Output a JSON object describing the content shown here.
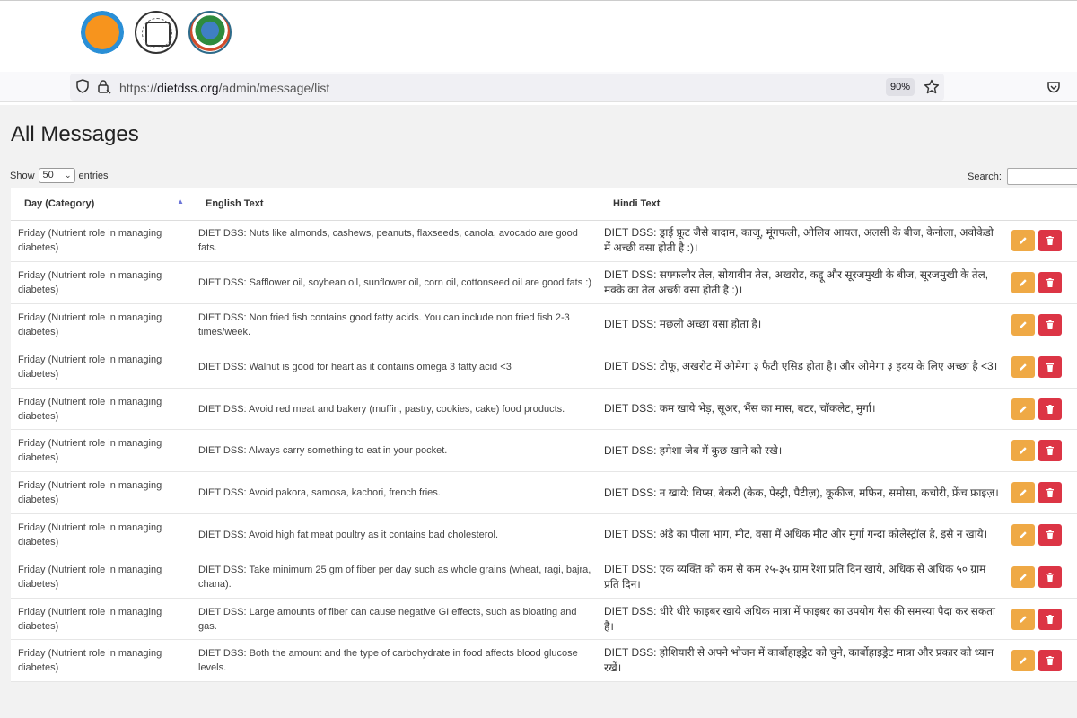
{
  "url": {
    "scheme": "https://",
    "host": "dietdss.org",
    "path": "/admin/message/list"
  },
  "zoom": "90%",
  "page": {
    "title": "All Messages",
    "show_label": "Show",
    "entries_value": "50",
    "entries_label": "entries",
    "search_label": "Search:"
  },
  "table": {
    "headers": [
      "Day (Category)",
      "English Text",
      "Hindi Text"
    ],
    "rows": [
      {
        "day": "Friday (Nutrient role in managing diabetes)",
        "english": "DIET DSS: Nuts like almonds, cashews, peanuts, flaxseeds, canola, avocado are good fats.",
        "hindi": "DIET DSS: ड्राई फ्रूट जैसे बादाम, काजू, मूंगफली, ओलिव आयल, अलसी के बीज, केनोला, अवोकेडो में अच्छी वसा होती है :)।"
      },
      {
        "day": "Friday (Nutrient role in managing diabetes)",
        "english": "DIET DSS: Safflower oil, soybean oil, sunflower oil, corn oil, cottonseed oil are good fats :)",
        "hindi": "DIET DSS: सफ्फलौर तेल, सोयाबीन तेल, अखरोट, कद्दू और सूरजमुखी के बीज, सूरजमुखी के तेल, मक्के का तेल अच्छी वसा होती है :)।"
      },
      {
        "day": "Friday (Nutrient role in managing diabetes)",
        "english": "DIET DSS: Non fried fish contains good fatty acids. You can include non fried fish 2-3 times/week.",
        "hindi": "DIET DSS: मछली अच्छा वसा होता है।"
      },
      {
        "day": "Friday (Nutrient role in managing diabetes)",
        "english": "DIET DSS: Walnut is good for heart as it contains omega 3 fatty acid <3",
        "hindi": "DIET DSS: टोफू, अखरोट में ओमेगा ३ फैटी एसिड होता है। और ओमेगा ३ हदय के लिए अच्छा है <3।"
      },
      {
        "day": "Friday (Nutrient role in managing diabetes)",
        "english": "DIET DSS: Avoid red meat and bakery (muffin, pastry, cookies, cake) food products.",
        "hindi": "DIET DSS: कम खाये भेड़, सूअर, भैंस का मास, बटर, चॉकलेट, मुर्गा।"
      },
      {
        "day": "Friday (Nutrient role in managing diabetes)",
        "english": "DIET DSS: Always carry something to eat in your pocket.",
        "hindi": "DIET DSS: हमेशा जेब में कुछ खाने को रखे।"
      },
      {
        "day": "Friday (Nutrient role in managing diabetes)",
        "english": "DIET DSS: Avoid pakora, samosa, kachori, french fries.",
        "hindi": "DIET DSS: न खाये: चिप्स, बेकरी (केक, पेस्ट्री, पैटीज़), कूकीज, मफिन, समोसा, कचोरी, फ्रेंच फ्राइज़।"
      },
      {
        "day": "Friday (Nutrient role in managing diabetes)",
        "english": "DIET DSS: Avoid high fat meat poultry as it contains bad cholesterol.",
        "hindi": "DIET DSS: अंडे का पीला भाग, मीट, वसा में अधिक मीट और मुर्गा गन्दा कोलेस्ट्रॉल है, इसे न खाये।"
      },
      {
        "day": "Friday (Nutrient role in managing diabetes)",
        "english": "DIET DSS: Take minimum 25 gm of fiber per day such as whole grains (wheat, ragi, bajra, chana).",
        "hindi": "DIET DSS: एक व्यक्ति को कम से कम २५-३५ ग्राम रेशा प्रति दिन खाये, अधिक से अधिक ५० ग्राम प्रति दिन।"
      },
      {
        "day": "Friday (Nutrient role in managing diabetes)",
        "english": "DIET DSS: Large amounts of fiber can cause negative GI effects, such as bloating and gas.",
        "hindi": "DIET DSS: धीरे धीरे फाइबर खाये अधिक मात्रा में फाइबर का उपयोग गैस की समस्या पैदा कर सकता है।"
      },
      {
        "day": "Friday (Nutrient role in managing diabetes)",
        "english": "DIET DSS: Both the amount and the type of carbohydrate in food affects blood glucose levels.",
        "hindi": "DIET DSS: होशियारी से अपने भोजन में कार्बोहाइड्रेट को चुने, कार्बोहाइड्रेट मात्रा और प्रकार को ध्यान रखें।"
      }
    ]
  },
  "colors": {
    "edit": "#efa945",
    "delete": "#dc3545",
    "sort": "#6c75d8"
  },
  "icons": [
    "shield-icon",
    "lock-icon",
    "star-icon",
    "pocket-icon",
    "pencil-icon",
    "trash-icon",
    "sort-asc-icon",
    "chevron-down-icon"
  ]
}
